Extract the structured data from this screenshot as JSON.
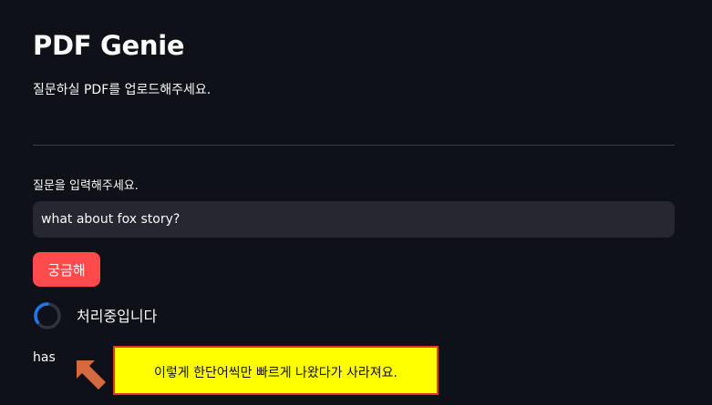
{
  "app": {
    "title": "PDF Genie",
    "subtitle": "질문하실 PDF를 업로드해주세요."
  },
  "question": {
    "label": "질문을 입력해주세요.",
    "value": "what about fox story?"
  },
  "actions": {
    "ask_label": "궁금해"
  },
  "status": {
    "spinner_text": "처리중입니다"
  },
  "output": {
    "text": "has"
  },
  "annotation": {
    "text": "이렇게 한단어씩만 빠르게 나왔다가 사라져요."
  },
  "colors": {
    "background": "#0e1117",
    "input_background": "#262730",
    "primary_button": "#ff4b4b",
    "spinner_accent": "#1f77e8",
    "annotation_background": "#ffff00",
    "annotation_border": "#e2362b",
    "arrow": "#d4683e"
  },
  "icons": {
    "spinner": "loading-spinner-icon",
    "arrow": "arrow-up-left-icon"
  }
}
